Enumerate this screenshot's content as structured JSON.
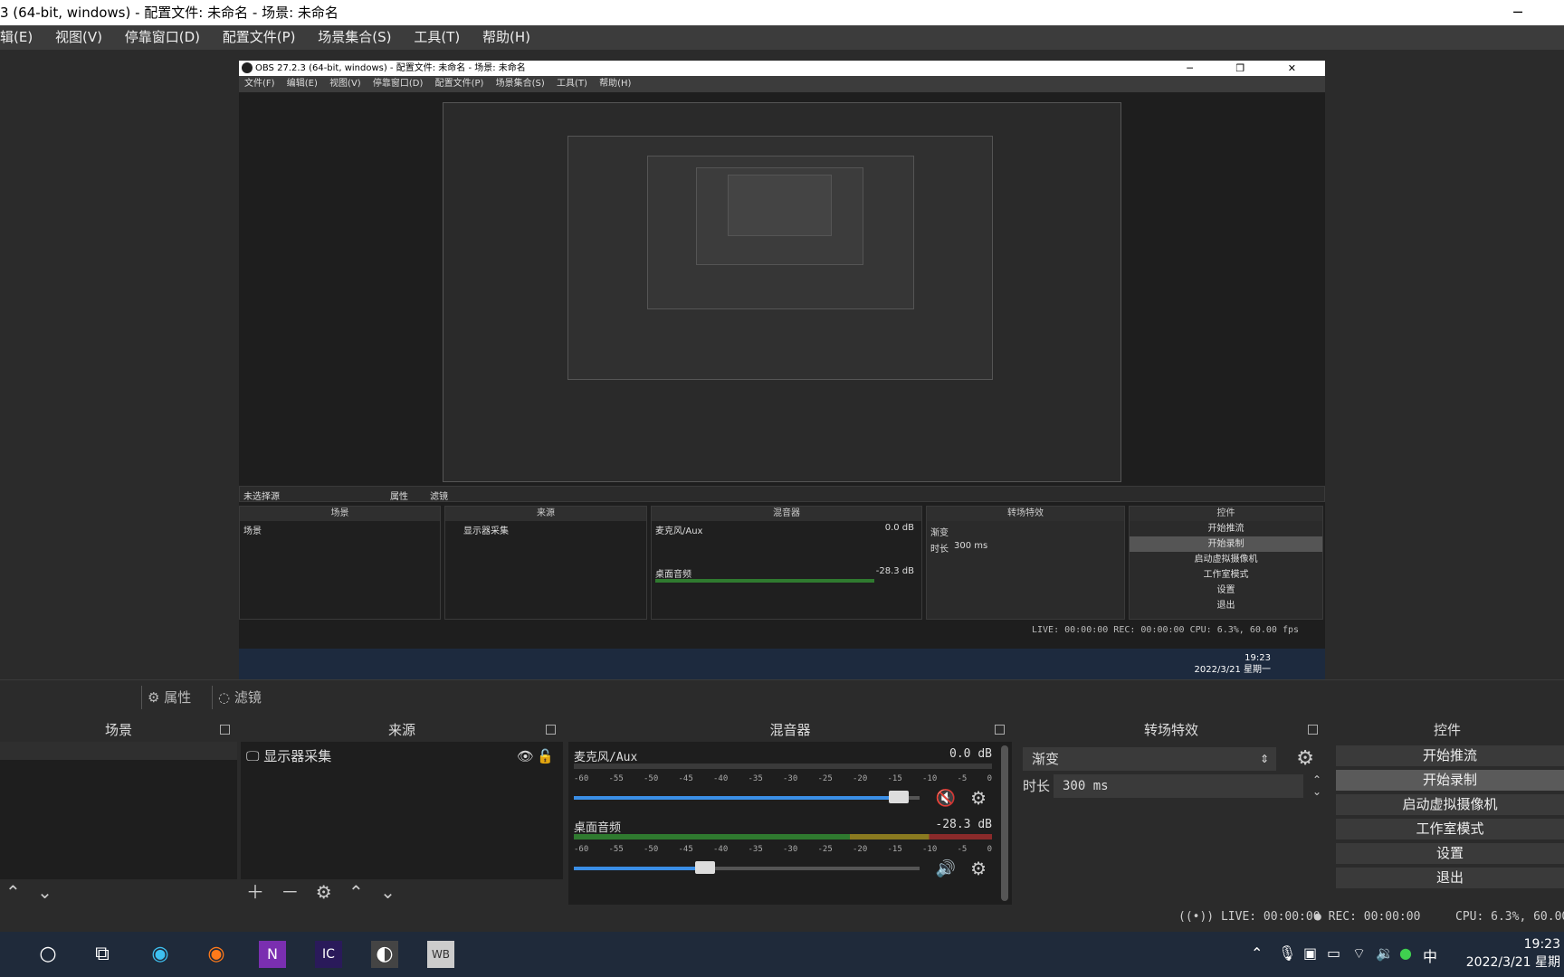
{
  "window": {
    "title": "3 (64-bit, windows) - 配置文件: 未命名 - 场景: 未命名",
    "minimize": "─"
  },
  "menu": {
    "items": [
      "辑(E)",
      "视图(V)",
      "停靠窗口(D)",
      "配置文件(P)",
      "场景集合(S)",
      "工具(T)",
      "帮助(H)"
    ]
  },
  "preview": {
    "inner_title": "OBS 27.2.3 (64-bit, windows) - 配置文件: 未命名 - 场景: 未命名",
    "inner_menu": [
      "文件(F)",
      "编辑(E)",
      "视图(V)",
      "停靠窗口(D)",
      "配置文件(P)",
      "场景集合(S)",
      "工具(T)",
      "帮助(H)"
    ],
    "inner_no_scene": "未选择源",
    "inner_props": "属性",
    "inner_filters": "滤镜",
    "inner_scenes": "场景",
    "inner_sources": "来源",
    "inner_mixer": "混音器",
    "inner_transitions": "转场特效",
    "inner_controls": "控件",
    "inner_scene_item": "场景",
    "inner_source_item": "显示器采集",
    "inner_mic": "麦克风/Aux",
    "inner_mic_db": "0.0 dB",
    "inner_desktop": "桌面音频",
    "inner_desktop_db": "-28.3 dB",
    "inner_transition_value": "渐变",
    "inner_duration_label": "时长",
    "inner_duration": "300 ms",
    "inner_controls_buttons": [
      "开始推流",
      "开始录制",
      "启动虚拟摄像机",
      "工作室模式",
      "设置",
      "退出"
    ],
    "inner_status": "LIVE: 00:00:00   REC: 00:00:00   CPU: 6.3%, 60.00 fps",
    "inner_clock_time": "19:23",
    "inner_clock_date": "2022/3/21 星期一"
  },
  "toolbar": {
    "properties": "属性",
    "filters": "滤镜"
  },
  "panels": {
    "scenes": {
      "title": "场景"
    },
    "sources": {
      "title": "来源",
      "items": [
        "显示器采集"
      ]
    },
    "mixer": {
      "title": "混音器",
      "channels": [
        {
          "name": "麦克风/Aux",
          "db": "0.0 dB",
          "level": 0.94
        },
        {
          "name": "桌面音频",
          "db": "-28.3 dB",
          "level": 0.38
        }
      ],
      "scale": [
        "-60",
        "-55",
        "-50",
        "-45",
        "-40",
        "-35",
        "-30",
        "-25",
        "-20",
        "-15",
        "-10",
        "-5",
        "0"
      ]
    },
    "transitions": {
      "title": "转场特效",
      "selected": "渐变",
      "duration_label": "时长",
      "duration": "300 ms"
    },
    "controls": {
      "title": "控件",
      "buttons": [
        "开始推流",
        "开始录制",
        "启动虚拟摄像机",
        "工作室模式",
        "设置",
        "退出"
      ]
    }
  },
  "status": {
    "live": "LIVE: 00:00:00",
    "rec": "REC: 00:00:00",
    "cpu": "CPU: 6.3%, 60.00"
  },
  "taskbar": {
    "ime": "中",
    "time": "19:23",
    "date": "2022/3/21 星期"
  }
}
